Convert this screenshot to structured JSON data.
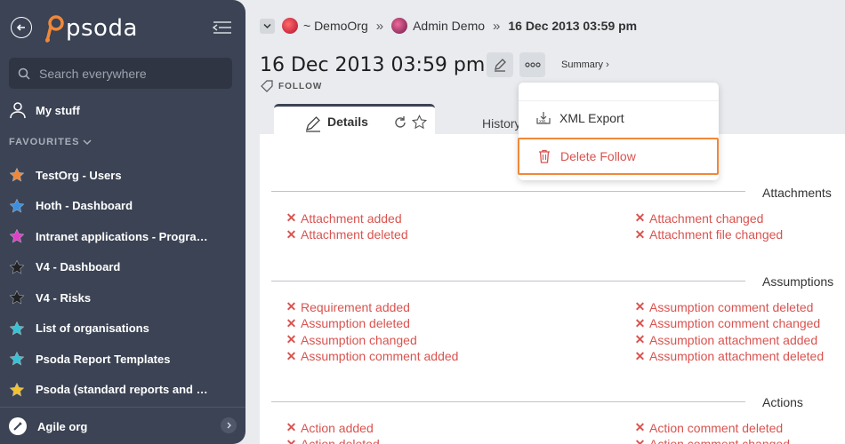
{
  "sidebar": {
    "brand": "psoda",
    "search_placeholder": "Search everywhere",
    "my_stuff": "My stuff",
    "favourites_header": "FAVOURITES",
    "favourites": [
      {
        "label": "TestOrg - Users",
        "color": "#f0883a"
      },
      {
        "label": "Hoth - Dashboard",
        "color": "#3b8fe0"
      },
      {
        "label": "Intranet applications - Programme...",
        "color": "#e040c8"
      },
      {
        "label": "V4 - Dashboard",
        "color": "#222222"
      },
      {
        "label": "V4 - Risks",
        "color": "#222222"
      },
      {
        "label": "List of organisations",
        "color": "#36c3d6"
      },
      {
        "label": "Psoda Report Templates",
        "color": "#36c3d6"
      },
      {
        "label": "Psoda (standard reports and work...",
        "color": "#f2c230"
      }
    ],
    "org": "Agile org"
  },
  "breadcrumb": {
    "org": "~ DemoOrg",
    "user": "Admin Demo",
    "current": "16 Dec 2013 03:59 pm"
  },
  "page": {
    "title": "16 Dec 2013 03:59 pm",
    "summary_link": "Summary ›",
    "type_tag": "FOLLOW"
  },
  "tabs": {
    "details": "Details",
    "history": "History"
  },
  "menu": {
    "xml_export": "XML Export",
    "delete_follow": "Delete Follow"
  },
  "sections": {
    "attachments": {
      "title": "Attachments",
      "left": [
        "Attachment added",
        "Attachment deleted"
      ],
      "right": [
        "Attachment changed",
        "Attachment file changed"
      ]
    },
    "assumptions": {
      "title": "Assumptions",
      "left": [
        "Requirement added",
        "Assumption deleted",
        "Assumption changed",
        "Assumption comment added"
      ],
      "right": [
        "Assumption comment deleted",
        "Assumption comment changed",
        "Assumption attachment added",
        "Assumption attachment deleted"
      ]
    },
    "actions": {
      "title": "Actions",
      "left": [
        "Action added",
        "Action deleted"
      ],
      "right": [
        "Action comment deleted",
        "Action comment changed"
      ]
    }
  },
  "colors": {
    "sidebar_bg": "#3b4354",
    "danger": "#d9534f",
    "highlight": "#f0883a"
  }
}
